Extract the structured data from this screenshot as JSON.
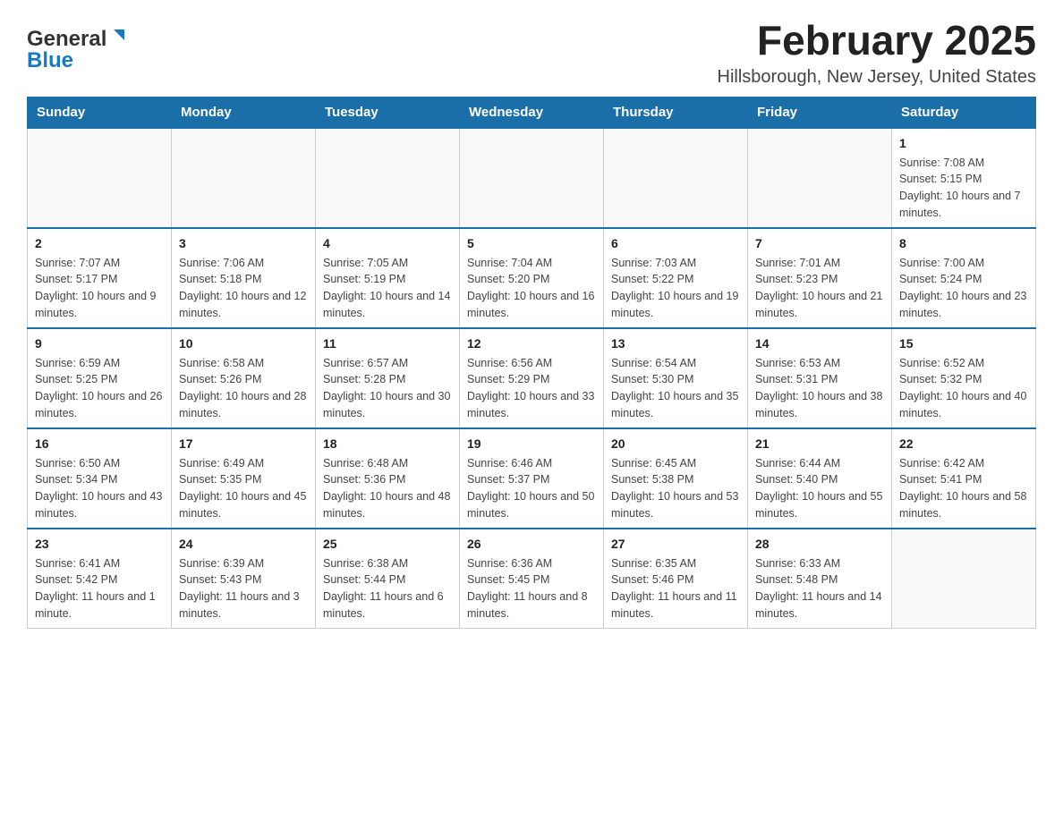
{
  "logo": {
    "general": "General",
    "blue": "Blue"
  },
  "header": {
    "month_title": "February 2025",
    "location": "Hillsborough, New Jersey, United States"
  },
  "days_of_week": [
    "Sunday",
    "Monday",
    "Tuesday",
    "Wednesday",
    "Thursday",
    "Friday",
    "Saturday"
  ],
  "weeks": [
    {
      "days": [
        {
          "number": "",
          "info": ""
        },
        {
          "number": "",
          "info": ""
        },
        {
          "number": "",
          "info": ""
        },
        {
          "number": "",
          "info": ""
        },
        {
          "number": "",
          "info": ""
        },
        {
          "number": "",
          "info": ""
        },
        {
          "number": "1",
          "info": "Sunrise: 7:08 AM\nSunset: 5:15 PM\nDaylight: 10 hours and 7 minutes."
        }
      ]
    },
    {
      "days": [
        {
          "number": "2",
          "info": "Sunrise: 7:07 AM\nSunset: 5:17 PM\nDaylight: 10 hours and 9 minutes."
        },
        {
          "number": "3",
          "info": "Sunrise: 7:06 AM\nSunset: 5:18 PM\nDaylight: 10 hours and 12 minutes."
        },
        {
          "number": "4",
          "info": "Sunrise: 7:05 AM\nSunset: 5:19 PM\nDaylight: 10 hours and 14 minutes."
        },
        {
          "number": "5",
          "info": "Sunrise: 7:04 AM\nSunset: 5:20 PM\nDaylight: 10 hours and 16 minutes."
        },
        {
          "number": "6",
          "info": "Sunrise: 7:03 AM\nSunset: 5:22 PM\nDaylight: 10 hours and 19 minutes."
        },
        {
          "number": "7",
          "info": "Sunrise: 7:01 AM\nSunset: 5:23 PM\nDaylight: 10 hours and 21 minutes."
        },
        {
          "number": "8",
          "info": "Sunrise: 7:00 AM\nSunset: 5:24 PM\nDaylight: 10 hours and 23 minutes."
        }
      ]
    },
    {
      "days": [
        {
          "number": "9",
          "info": "Sunrise: 6:59 AM\nSunset: 5:25 PM\nDaylight: 10 hours and 26 minutes."
        },
        {
          "number": "10",
          "info": "Sunrise: 6:58 AM\nSunset: 5:26 PM\nDaylight: 10 hours and 28 minutes."
        },
        {
          "number": "11",
          "info": "Sunrise: 6:57 AM\nSunset: 5:28 PM\nDaylight: 10 hours and 30 minutes."
        },
        {
          "number": "12",
          "info": "Sunrise: 6:56 AM\nSunset: 5:29 PM\nDaylight: 10 hours and 33 minutes."
        },
        {
          "number": "13",
          "info": "Sunrise: 6:54 AM\nSunset: 5:30 PM\nDaylight: 10 hours and 35 minutes."
        },
        {
          "number": "14",
          "info": "Sunrise: 6:53 AM\nSunset: 5:31 PM\nDaylight: 10 hours and 38 minutes."
        },
        {
          "number": "15",
          "info": "Sunrise: 6:52 AM\nSunset: 5:32 PM\nDaylight: 10 hours and 40 minutes."
        }
      ]
    },
    {
      "days": [
        {
          "number": "16",
          "info": "Sunrise: 6:50 AM\nSunset: 5:34 PM\nDaylight: 10 hours and 43 minutes."
        },
        {
          "number": "17",
          "info": "Sunrise: 6:49 AM\nSunset: 5:35 PM\nDaylight: 10 hours and 45 minutes."
        },
        {
          "number": "18",
          "info": "Sunrise: 6:48 AM\nSunset: 5:36 PM\nDaylight: 10 hours and 48 minutes."
        },
        {
          "number": "19",
          "info": "Sunrise: 6:46 AM\nSunset: 5:37 PM\nDaylight: 10 hours and 50 minutes."
        },
        {
          "number": "20",
          "info": "Sunrise: 6:45 AM\nSunset: 5:38 PM\nDaylight: 10 hours and 53 minutes."
        },
        {
          "number": "21",
          "info": "Sunrise: 6:44 AM\nSunset: 5:40 PM\nDaylight: 10 hours and 55 minutes."
        },
        {
          "number": "22",
          "info": "Sunrise: 6:42 AM\nSunset: 5:41 PM\nDaylight: 10 hours and 58 minutes."
        }
      ]
    },
    {
      "days": [
        {
          "number": "23",
          "info": "Sunrise: 6:41 AM\nSunset: 5:42 PM\nDaylight: 11 hours and 1 minute."
        },
        {
          "number": "24",
          "info": "Sunrise: 6:39 AM\nSunset: 5:43 PM\nDaylight: 11 hours and 3 minutes."
        },
        {
          "number": "25",
          "info": "Sunrise: 6:38 AM\nSunset: 5:44 PM\nDaylight: 11 hours and 6 minutes."
        },
        {
          "number": "26",
          "info": "Sunrise: 6:36 AM\nSunset: 5:45 PM\nDaylight: 11 hours and 8 minutes."
        },
        {
          "number": "27",
          "info": "Sunrise: 6:35 AM\nSunset: 5:46 PM\nDaylight: 11 hours and 11 minutes."
        },
        {
          "number": "28",
          "info": "Sunrise: 6:33 AM\nSunset: 5:48 PM\nDaylight: 11 hours and 14 minutes."
        },
        {
          "number": "",
          "info": ""
        }
      ]
    }
  ]
}
